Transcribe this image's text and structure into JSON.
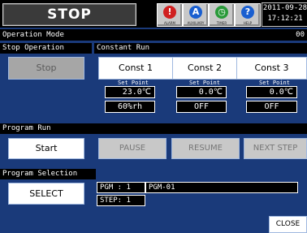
{
  "header": {
    "status": "STOP",
    "icons": [
      {
        "name": "alarm-icon",
        "glyph": "!",
        "label": "ALARM",
        "color": "#d02020"
      },
      {
        "name": "auxiliary-icon",
        "glyph": "A",
        "label": "AUXILIARY",
        "color": "#1a5fd0"
      },
      {
        "name": "timer-icon",
        "glyph": "◷",
        "label": "TIMER",
        "color": "#2a9a3a"
      },
      {
        "name": "help-icon",
        "glyph": "?",
        "label": "HELP",
        "color": "#1a5fd0"
      }
    ],
    "date": "2011-09-28",
    "time": "17:12:21"
  },
  "mode": {
    "title": "Operation Mode",
    "code": "00"
  },
  "stop_operation": {
    "title": "Stop Operation",
    "button": "Stop"
  },
  "constant_run": {
    "title": "Constant Run",
    "set_point_label": "Set Point",
    "items": [
      {
        "button": "Const  1",
        "set_point": "23.0℃",
        "value2": "60%rh"
      },
      {
        "button": "Const  2",
        "set_point": "0.0℃",
        "value2": "OFF"
      },
      {
        "button": "Const  3",
        "set_point": "0.0℃",
        "value2": "OFF"
      }
    ]
  },
  "program_run": {
    "title": "Program Run",
    "start": "Start",
    "pause": "PAUSE",
    "resume": "RESUME",
    "next_step": "NEXT STEP"
  },
  "program_selection": {
    "title": "Program Selection",
    "select": "SELECT",
    "pgm_label": "PGM : 1",
    "pgm_name": "PGM-01",
    "step_label": "STEP: 1"
  },
  "close": "CLOSE",
  "colors": {
    "background": "#1a3a7a",
    "panel": "#000000",
    "button": "#ffffff",
    "disabled": "#c8c8c8"
  }
}
